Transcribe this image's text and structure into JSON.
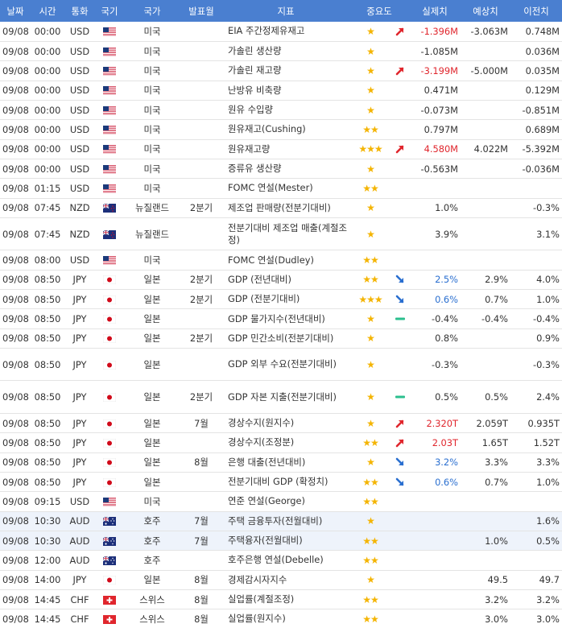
{
  "headers": {
    "date": "날짜",
    "time": "시간",
    "currency": "통화",
    "flag": "국기",
    "country": "국가",
    "period": "발표월",
    "indicator": "지표",
    "importance": "중요도",
    "actual": "실제치",
    "forecast": "예상치",
    "previous": "이전치"
  },
  "colors": {
    "header_bg": "#4a7fd0",
    "up": "#e0262d",
    "down": "#2a6fd0",
    "flat": "#2bbf8e",
    "star": "#f4b400"
  },
  "rows": [
    {
      "date": "09/08",
      "time": "00:00",
      "currency": "USD",
      "flag": "us-flag-icon",
      "country": "미국",
      "period": "",
      "indicator": "EIA 주간정제유재고",
      "importance": "★",
      "trend": "up",
      "actual": "-1.396M",
      "actual_color": "red",
      "forecast": "-3.063M",
      "previous": "0.748M"
    },
    {
      "date": "09/08",
      "time": "00:00",
      "currency": "USD",
      "flag": "us-flag-icon",
      "country": "미국",
      "period": "",
      "indicator": "가솔린 생산량",
      "importance": "★",
      "trend": "",
      "actual": "-1.085M",
      "actual_color": "",
      "forecast": "",
      "previous": "0.036M"
    },
    {
      "date": "09/08",
      "time": "00:00",
      "currency": "USD",
      "flag": "us-flag-icon",
      "country": "미국",
      "period": "",
      "indicator": "가솔린 재고량",
      "importance": "★",
      "trend": "up",
      "actual": "-3.199M",
      "actual_color": "red",
      "forecast": "-5.000M",
      "previous": "0.035M"
    },
    {
      "date": "09/08",
      "time": "00:00",
      "currency": "USD",
      "flag": "us-flag-icon",
      "country": "미국",
      "period": "",
      "indicator": "난방유 비축량",
      "importance": "★",
      "trend": "",
      "actual": "0.471M",
      "actual_color": "",
      "forecast": "",
      "previous": "0.129M"
    },
    {
      "date": "09/08",
      "time": "00:00",
      "currency": "USD",
      "flag": "us-flag-icon",
      "country": "미국",
      "period": "",
      "indicator": "원유 수입량",
      "importance": "★",
      "trend": "",
      "actual": "-0.073M",
      "actual_color": "",
      "forecast": "",
      "previous": "-0.851M"
    },
    {
      "date": "09/08",
      "time": "00:00",
      "currency": "USD",
      "flag": "us-flag-icon",
      "country": "미국",
      "period": "",
      "indicator": "원유재고(Cushing)",
      "importance": "★★",
      "trend": "",
      "actual": "0.797M",
      "actual_color": "",
      "forecast": "",
      "previous": "0.689M"
    },
    {
      "date": "09/08",
      "time": "00:00",
      "currency": "USD",
      "flag": "us-flag-icon",
      "country": "미국",
      "period": "",
      "indicator": "원유재고량",
      "importance": "★★★",
      "trend": "up",
      "actual": "4.580M",
      "actual_color": "red",
      "forecast": "4.022M",
      "previous": "-5.392M"
    },
    {
      "date": "09/08",
      "time": "00:00",
      "currency": "USD",
      "flag": "us-flag-icon",
      "country": "미국",
      "period": "",
      "indicator": "증류유 생산량",
      "importance": "★",
      "trend": "",
      "actual": "-0.563M",
      "actual_color": "",
      "forecast": "",
      "previous": "-0.036M"
    },
    {
      "date": "09/08",
      "time": "01:15",
      "currency": "USD",
      "flag": "us-flag-icon",
      "country": "미국",
      "period": "",
      "indicator": "FOMC 연설(Mester)",
      "importance": "★★",
      "trend": "",
      "actual": "",
      "actual_color": "",
      "forecast": "",
      "previous": ""
    },
    {
      "date": "09/08",
      "time": "07:45",
      "currency": "NZD",
      "flag": "nz-flag-icon",
      "country": "뉴질랜드",
      "period": "2분기",
      "indicator": "제조업 판매량(전분기대비)",
      "importance": "★",
      "trend": "",
      "actual": "1.0%",
      "actual_color": "",
      "forecast": "",
      "previous": "-0.3%"
    },
    {
      "date": "09/08",
      "time": "07:45",
      "currency": "NZD",
      "flag": "nz-flag-icon",
      "country": "뉴질랜드",
      "period": "",
      "indicator": "전분기대비 제조업 매출(계절조정)",
      "importance": "★",
      "trend": "",
      "actual": "3.9%",
      "actual_color": "",
      "forecast": "",
      "previous": "3.1%",
      "tall": true
    },
    {
      "date": "09/08",
      "time": "08:00",
      "currency": "USD",
      "flag": "us-flag-icon",
      "country": "미국",
      "period": "",
      "indicator": "FOMC 연설(Dudley)",
      "importance": "★★",
      "trend": "",
      "actual": "",
      "actual_color": "",
      "forecast": "",
      "previous": ""
    },
    {
      "date": "09/08",
      "time": "08:50",
      "currency": "JPY",
      "flag": "jp-flag-icon",
      "country": "일본",
      "period": "2분기",
      "indicator": "GDP (전년대비)",
      "importance": "★★",
      "trend": "down",
      "actual": "2.5%",
      "actual_color": "blue",
      "forecast": "2.9%",
      "previous": "4.0%"
    },
    {
      "date": "09/08",
      "time": "08:50",
      "currency": "JPY",
      "flag": "jp-flag-icon",
      "country": "일본",
      "period": "2분기",
      "indicator": "GDP (전분기대비)",
      "importance": "★★★",
      "trend": "down",
      "actual": "0.6%",
      "actual_color": "blue",
      "forecast": "0.7%",
      "previous": "1.0%"
    },
    {
      "date": "09/08",
      "time": "08:50",
      "currency": "JPY",
      "flag": "jp-flag-icon",
      "country": "일본",
      "period": "",
      "indicator": "GDP 물가지수(전년대비)",
      "importance": "★",
      "trend": "flat",
      "actual": "-0.4%",
      "actual_color": "",
      "forecast": "-0.4%",
      "previous": "-0.4%"
    },
    {
      "date": "09/08",
      "time": "08:50",
      "currency": "JPY",
      "flag": "jp-flag-icon",
      "country": "일본",
      "period": "2분기",
      "indicator": "GDP 민간소비(전분기대비)",
      "importance": "★",
      "trend": "",
      "actual": "0.8%",
      "actual_color": "",
      "forecast": "",
      "previous": "0.9%"
    },
    {
      "date": "09/08",
      "time": "08:50",
      "currency": "JPY",
      "flag": "jp-flag-icon",
      "country": "일본",
      "period": "",
      "indicator": "GDP 외부 수요(전분기대비)",
      "importance": "★",
      "trend": "",
      "actual": "-0.3%",
      "actual_color": "",
      "forecast": "",
      "previous": "-0.3%",
      "tall": true
    },
    {
      "date": "09/08",
      "time": "08:50",
      "currency": "JPY",
      "flag": "jp-flag-icon",
      "country": "일본",
      "period": "2분기",
      "indicator": "GDP 자본 지출(전분기대비)",
      "importance": "★",
      "trend": "flat",
      "actual": "0.5%",
      "actual_color": "",
      "forecast": "0.5%",
      "previous": "2.4%",
      "tall": true
    },
    {
      "date": "09/08",
      "time": "08:50",
      "currency": "JPY",
      "flag": "jp-flag-icon",
      "country": "일본",
      "period": "7월",
      "indicator": "경상수지(원지수)",
      "importance": "★",
      "trend": "up",
      "actual": "2.320T",
      "actual_color": "red",
      "forecast": "2.059T",
      "previous": "0.935T"
    },
    {
      "date": "09/08",
      "time": "08:50",
      "currency": "JPY",
      "flag": "jp-flag-icon",
      "country": "일본",
      "period": "",
      "indicator": "경상수지(조정분)",
      "importance": "★★",
      "trend": "up",
      "actual": "2.03T",
      "actual_color": "red",
      "forecast": "1.65T",
      "previous": "1.52T"
    },
    {
      "date": "09/08",
      "time": "08:50",
      "currency": "JPY",
      "flag": "jp-flag-icon",
      "country": "일본",
      "period": "8월",
      "indicator": "은행 대출(전년대비)",
      "importance": "★",
      "trend": "down",
      "actual": "3.2%",
      "actual_color": "blue",
      "forecast": "3.3%",
      "previous": "3.3%"
    },
    {
      "date": "09/08",
      "time": "08:50",
      "currency": "JPY",
      "flag": "jp-flag-icon",
      "country": "일본",
      "period": "",
      "indicator": "전분기대비 GDP (확정치)",
      "importance": "★★",
      "trend": "down",
      "actual": "0.6%",
      "actual_color": "blue",
      "forecast": "0.7%",
      "previous": "1.0%"
    },
    {
      "date": "09/08",
      "time": "09:15",
      "currency": "USD",
      "flag": "us-flag-icon",
      "country": "미국",
      "period": "",
      "indicator": "연준 연설(George)",
      "importance": "★★",
      "trend": "",
      "actual": "",
      "actual_color": "",
      "forecast": "",
      "previous": ""
    },
    {
      "date": "09/08",
      "time": "10:30",
      "currency": "AUD",
      "flag": "au-flag-icon",
      "country": "호주",
      "period": "7월",
      "indicator": "주택 금융투자(전월대비)",
      "importance": "★",
      "trend": "",
      "actual": "",
      "actual_color": "",
      "forecast": "",
      "previous": "1.6%",
      "hl": true
    },
    {
      "date": "09/08",
      "time": "10:30",
      "currency": "AUD",
      "flag": "au-flag-icon",
      "country": "호주",
      "period": "7월",
      "indicator": "주택융자(전월대비)",
      "importance": "★★",
      "trend": "",
      "actual": "",
      "actual_color": "",
      "forecast": "1.0%",
      "previous": "0.5%",
      "hl": true
    },
    {
      "date": "09/08",
      "time": "12:00",
      "currency": "AUD",
      "flag": "au-flag-icon",
      "country": "호주",
      "period": "",
      "indicator": "호주은행 연설(Debelle)",
      "importance": "★★",
      "trend": "",
      "actual": "",
      "actual_color": "",
      "forecast": "",
      "previous": ""
    },
    {
      "date": "09/08",
      "time": "14:00",
      "currency": "JPY",
      "flag": "jp-flag-icon",
      "country": "일본",
      "period": "8월",
      "indicator": "경제감시자지수",
      "importance": "★",
      "trend": "",
      "actual": "",
      "actual_color": "",
      "forecast": "49.5",
      "previous": "49.7"
    },
    {
      "date": "09/08",
      "time": "14:45",
      "currency": "CHF",
      "flag": "ch-flag-icon",
      "country": "스위스",
      "period": "8월",
      "indicator": "실업률(계절조정)",
      "importance": "★★",
      "trend": "",
      "actual": "",
      "actual_color": "",
      "forecast": "3.2%",
      "previous": "3.2%"
    },
    {
      "date": "09/08",
      "time": "14:45",
      "currency": "CHF",
      "flag": "ch-flag-icon",
      "country": "스위스",
      "period": "8월",
      "indicator": "실업률(원지수)",
      "importance": "★★",
      "trend": "",
      "actual": "",
      "actual_color": "",
      "forecast": "3.0%",
      "previous": "3.0%"
    }
  ]
}
